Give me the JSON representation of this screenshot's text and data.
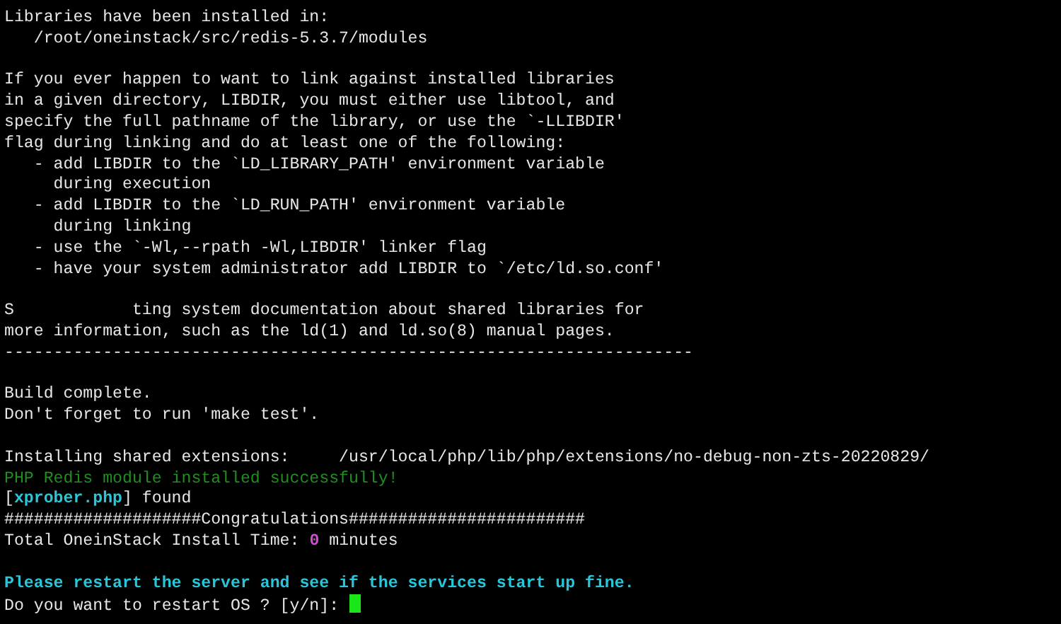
{
  "terminal": {
    "lines": [
      {
        "kind": "text",
        "segments": [
          {
            "kind": "normal",
            "text": "Libraries have been installed in:"
          }
        ]
      },
      {
        "kind": "text",
        "segments": [
          {
            "kind": "normal",
            "text": "   /root/oneinstack/src/redis-5.3.7/modules"
          }
        ]
      },
      {
        "kind": "blank"
      },
      {
        "kind": "text",
        "segments": [
          {
            "kind": "normal",
            "text": "If you ever happen to want to link against installed libraries"
          }
        ]
      },
      {
        "kind": "text",
        "segments": [
          {
            "kind": "normal",
            "text": "in a given directory, LIBDIR, you must either use libtool, and"
          }
        ]
      },
      {
        "kind": "text",
        "segments": [
          {
            "kind": "normal",
            "text": "specify the full pathname of the library, or use the `-LLIBDIR'"
          }
        ]
      },
      {
        "kind": "text",
        "segments": [
          {
            "kind": "normal",
            "text": "flag during linking and do at least one of the following:"
          }
        ]
      },
      {
        "kind": "text",
        "segments": [
          {
            "kind": "normal",
            "text": "   - add LIBDIR to the `LD_LIBRARY_PATH' environment variable"
          }
        ]
      },
      {
        "kind": "text",
        "segments": [
          {
            "kind": "normal",
            "text": "     during execution"
          }
        ]
      },
      {
        "kind": "text",
        "segments": [
          {
            "kind": "normal",
            "text": "   - add LIBDIR to the `LD_RUN_PATH' environment variable"
          }
        ]
      },
      {
        "kind": "text",
        "segments": [
          {
            "kind": "normal",
            "text": "     during linking"
          }
        ]
      },
      {
        "kind": "text",
        "segments": [
          {
            "kind": "normal",
            "text": "   - use the `-Wl,--rpath -Wl,LIBDIR' linker flag"
          }
        ]
      },
      {
        "kind": "text",
        "segments": [
          {
            "kind": "normal",
            "text": "   - have your system administrator add LIBDIR to `/etc/ld.so.conf'"
          }
        ]
      },
      {
        "kind": "blank"
      },
      {
        "kind": "text",
        "segments": [
          {
            "kind": "normal",
            "text": "S            ting system documentation about shared libraries for"
          }
        ]
      },
      {
        "kind": "text",
        "segments": [
          {
            "kind": "normal",
            "text": "more information, such as the ld(1) and ld.so(8) manual pages."
          }
        ]
      },
      {
        "kind": "text",
        "segments": [
          {
            "kind": "normal",
            "text": "----------------------------------------------------------------------"
          }
        ]
      },
      {
        "kind": "blank"
      },
      {
        "kind": "text",
        "segments": [
          {
            "kind": "normal",
            "text": "Build complete."
          }
        ]
      },
      {
        "kind": "text",
        "segments": [
          {
            "kind": "normal",
            "text": "Don't forget to run 'make test'."
          }
        ]
      },
      {
        "kind": "blank"
      },
      {
        "kind": "text",
        "segments": [
          {
            "kind": "normal",
            "text": "Installing shared extensions:     /usr/local/php/lib/php/extensions/no-debug-non-zts-20220829/"
          }
        ]
      },
      {
        "kind": "text",
        "segments": [
          {
            "kind": "success",
            "text": "PHP Redis module installed successfully!"
          }
        ]
      },
      {
        "kind": "text",
        "segments": [
          {
            "kind": "normal",
            "text": "["
          },
          {
            "kind": "highlight",
            "text": "xprober.php"
          },
          {
            "kind": "normal",
            "text": "] found"
          }
        ]
      },
      {
        "kind": "text",
        "segments": [
          {
            "kind": "normal",
            "text": "####################Congratulations########################"
          }
        ]
      },
      {
        "kind": "text",
        "segments": [
          {
            "kind": "normal",
            "text": "Total OneinStack Install Time: "
          },
          {
            "kind": "number",
            "text": "0"
          },
          {
            "kind": "normal",
            "text": " minutes"
          }
        ]
      },
      {
        "kind": "blank"
      },
      {
        "kind": "text",
        "segments": [
          {
            "kind": "highlight",
            "text": "Please restart the server and see if the services start up fine."
          }
        ]
      },
      {
        "kind": "prompt",
        "text": "Do you want to restart OS ? [y/n]: "
      }
    ]
  }
}
